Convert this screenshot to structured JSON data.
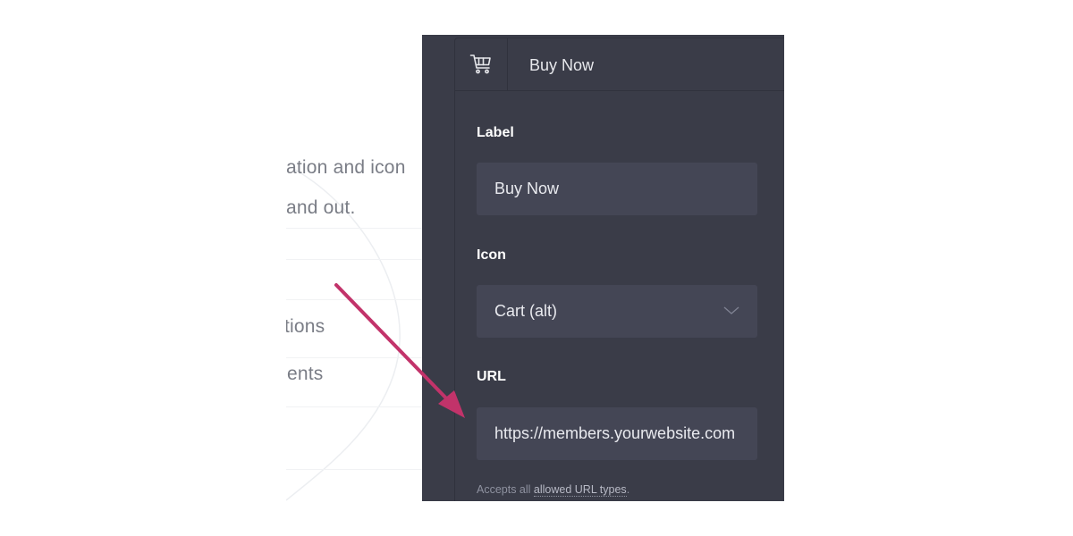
{
  "background_page": {
    "lines": [
      "ation and icon",
      "and out.",
      "tions",
      "ents"
    ]
  },
  "panel": {
    "header": {
      "icon": "shopping-cart-icon",
      "title": "Buy Now"
    },
    "label_field": {
      "label": "Label",
      "value": "Buy Now"
    },
    "icon_field": {
      "label": "Icon",
      "value": "Cart (alt)",
      "icon": "chevron-down-icon"
    },
    "url_field": {
      "label": "URL",
      "value": "https://members.yourwebsite.com"
    },
    "hint": {
      "prefix": "Accepts all ",
      "link": "allowed URL types",
      "suffix": "."
    }
  },
  "annotation": {
    "type": "arrow",
    "color": "#c2336a"
  },
  "colors": {
    "panel_bg": "#3a3c48",
    "field_bg": "#444655",
    "accent_arrow": "#c2336a"
  }
}
